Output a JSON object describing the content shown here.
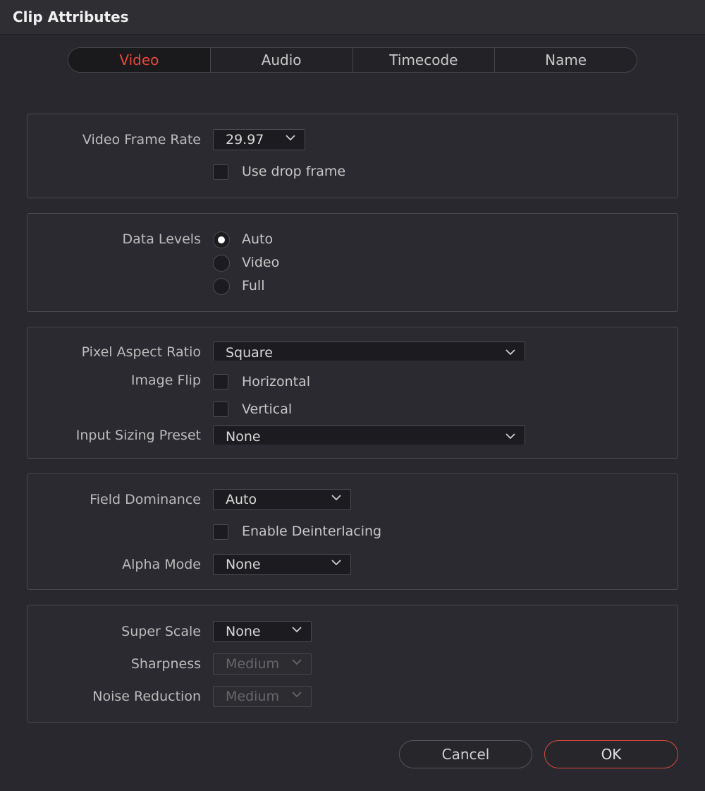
{
  "window": {
    "title": "Clip Attributes"
  },
  "tabs": [
    {
      "label": "Video",
      "active": true
    },
    {
      "label": "Audio",
      "active": false
    },
    {
      "label": "Timecode",
      "active": false
    },
    {
      "label": "Name",
      "active": false
    }
  ],
  "frame_rate": {
    "label": "Video Frame Rate",
    "value": "29.97",
    "drop_frame_label": "Use drop frame",
    "drop_frame_checked": false
  },
  "data_levels": {
    "label": "Data Levels",
    "options": [
      {
        "label": "Auto",
        "selected": true
      },
      {
        "label": "Video",
        "selected": false
      },
      {
        "label": "Full",
        "selected": false
      }
    ]
  },
  "image": {
    "pixel_aspect_label": "Pixel Aspect Ratio",
    "pixel_aspect_value": "Square",
    "image_flip_label": "Image Flip",
    "flip_horizontal_label": "Horizontal",
    "flip_horizontal_checked": false,
    "flip_vertical_label": "Vertical",
    "flip_vertical_checked": false,
    "input_sizing_label": "Input Sizing Preset",
    "input_sizing_value": "None"
  },
  "field": {
    "field_dominance_label": "Field Dominance",
    "field_dominance_value": "Auto",
    "deinterlace_label": "Enable Deinterlacing",
    "deinterlace_checked": false,
    "alpha_mode_label": "Alpha Mode",
    "alpha_mode_value": "None"
  },
  "super_scale": {
    "super_scale_label": "Super Scale",
    "super_scale_value": "None",
    "sharpness_label": "Sharpness",
    "sharpness_value": "Medium",
    "noise_reduction_label": "Noise Reduction",
    "noise_reduction_value": "Medium"
  },
  "buttons": {
    "cancel": "Cancel",
    "ok": "OK"
  },
  "colors": {
    "accent": "#e8483a",
    "background": "#28282e",
    "field": "#1c1c20"
  }
}
